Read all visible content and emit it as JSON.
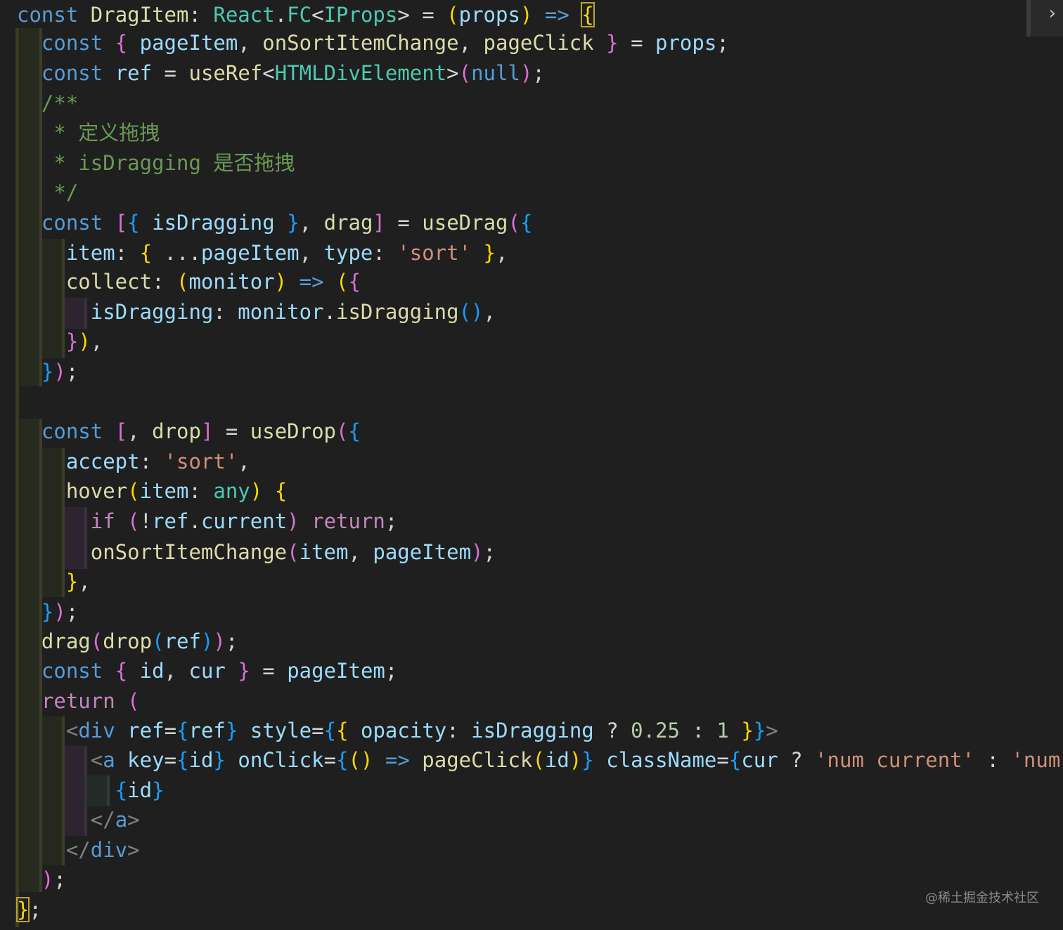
{
  "editor": {
    "lines": [
      [
        [
          "k",
          "const"
        ],
        [
          "p",
          " "
        ],
        [
          "f",
          "DragItem"
        ],
        [
          "p",
          ": "
        ],
        [
          "t",
          "React"
        ],
        [
          "p",
          "."
        ],
        [
          "t",
          "FC"
        ],
        [
          "p",
          "<"
        ],
        [
          "t",
          "IProps"
        ],
        [
          "p",
          "> = "
        ],
        [
          "b1",
          "("
        ],
        [
          "v",
          "props"
        ],
        [
          "b1",
          ")"
        ],
        [
          "p",
          " "
        ],
        [
          "k",
          "=>"
        ],
        [
          "p",
          " "
        ],
        [
          "b1m",
          "{"
        ]
      ],
      [
        [
          "p",
          "  "
        ],
        [
          "k",
          "const"
        ],
        [
          "p",
          " "
        ],
        [
          "b2",
          "{"
        ],
        [
          "p",
          " "
        ],
        [
          "v",
          "pageItem"
        ],
        [
          "p",
          ", "
        ],
        [
          "f",
          "onSortItemChange"
        ],
        [
          "p",
          ", "
        ],
        [
          "f",
          "pageClick"
        ],
        [
          "p",
          " "
        ],
        [
          "b2",
          "}"
        ],
        [
          "p",
          " = "
        ],
        [
          "v",
          "props"
        ],
        [
          "p",
          ";"
        ]
      ],
      [
        [
          "p",
          "  "
        ],
        [
          "k",
          "const"
        ],
        [
          "p",
          " "
        ],
        [
          "v",
          "ref"
        ],
        [
          "p",
          " = "
        ],
        [
          "f",
          "useRef"
        ],
        [
          "p",
          "<"
        ],
        [
          "t",
          "HTMLDivElement"
        ],
        [
          "p",
          ">"
        ],
        [
          "b2",
          "("
        ],
        [
          "k",
          "null"
        ],
        [
          "b2",
          ")"
        ],
        [
          "p",
          ";"
        ]
      ],
      [
        [
          "p",
          "  "
        ],
        [
          "c",
          "/**"
        ]
      ],
      [
        [
          "p",
          "   "
        ],
        [
          "c",
          "* 定义拖拽"
        ]
      ],
      [
        [
          "p",
          "   "
        ],
        [
          "c",
          "* isDragging 是否拖拽"
        ]
      ],
      [
        [
          "p",
          "   "
        ],
        [
          "c",
          "*/"
        ]
      ],
      [
        [
          "p",
          "  "
        ],
        [
          "k",
          "const"
        ],
        [
          "p",
          " "
        ],
        [
          "b2",
          "["
        ],
        [
          "b3",
          "{"
        ],
        [
          "p",
          " "
        ],
        [
          "v",
          "isDragging"
        ],
        [
          "p",
          " "
        ],
        [
          "b3",
          "}"
        ],
        [
          "p",
          ", "
        ],
        [
          "f",
          "drag"
        ],
        [
          "b2",
          "]"
        ],
        [
          "p",
          " = "
        ],
        [
          "f",
          "useDrag"
        ],
        [
          "b2",
          "("
        ],
        [
          "b3",
          "{"
        ]
      ],
      [
        [
          "p",
          "    "
        ],
        [
          "v",
          "item"
        ],
        [
          "p",
          ": "
        ],
        [
          "b1",
          "{"
        ],
        [
          "p",
          " ..."
        ],
        [
          "v",
          "pageItem"
        ],
        [
          "p",
          ", "
        ],
        [
          "v",
          "type"
        ],
        [
          "p",
          ": "
        ],
        [
          "s",
          "'sort'"
        ],
        [
          "p",
          " "
        ],
        [
          "b1",
          "}"
        ],
        [
          "p",
          ","
        ]
      ],
      [
        [
          "p",
          "    "
        ],
        [
          "f",
          "collect"
        ],
        [
          "p",
          ": "
        ],
        [
          "b1",
          "("
        ],
        [
          "v",
          "monitor"
        ],
        [
          "b1",
          ")"
        ],
        [
          "p",
          " "
        ],
        [
          "k",
          "=>"
        ],
        [
          "p",
          " "
        ],
        [
          "b1",
          "("
        ],
        [
          "b2",
          "{"
        ]
      ],
      [
        [
          "p",
          "      "
        ],
        [
          "v",
          "isDragging"
        ],
        [
          "p",
          ": "
        ],
        [
          "v",
          "monitor"
        ],
        [
          "p",
          "."
        ],
        [
          "f",
          "isDragging"
        ],
        [
          "b3",
          "()"
        ],
        [
          "p",
          ","
        ]
      ],
      [
        [
          "p",
          "    "
        ],
        [
          "b2",
          "}"
        ],
        [
          "b1",
          ")"
        ],
        [
          "p",
          ","
        ]
      ],
      [
        [
          "p",
          "  "
        ],
        [
          "b3",
          "}"
        ],
        [
          "b2",
          ")"
        ],
        [
          "p",
          ";"
        ]
      ],
      [],
      [
        [
          "p",
          "  "
        ],
        [
          "k",
          "const"
        ],
        [
          "p",
          " "
        ],
        [
          "b2",
          "["
        ],
        [
          "p",
          ", "
        ],
        [
          "f",
          "drop"
        ],
        [
          "b2",
          "]"
        ],
        [
          "p",
          " = "
        ],
        [
          "f",
          "useDrop"
        ],
        [
          "b2",
          "("
        ],
        [
          "b3",
          "{"
        ]
      ],
      [
        [
          "p",
          "    "
        ],
        [
          "v",
          "accept"
        ],
        [
          "p",
          ": "
        ],
        [
          "s",
          "'sort'"
        ],
        [
          "p",
          ","
        ]
      ],
      [
        [
          "p",
          "    "
        ],
        [
          "f",
          "hover"
        ],
        [
          "b1",
          "("
        ],
        [
          "v",
          "item"
        ],
        [
          "p",
          ": "
        ],
        [
          "t",
          "any"
        ],
        [
          "b1",
          ")"
        ],
        [
          "p",
          " "
        ],
        [
          "b1",
          "{"
        ]
      ],
      [
        [
          "p",
          "      "
        ],
        [
          "ct",
          "if"
        ],
        [
          "p",
          " "
        ],
        [
          "b2",
          "("
        ],
        [
          "p",
          "!"
        ],
        [
          "v",
          "ref"
        ],
        [
          "p",
          "."
        ],
        [
          "v",
          "current"
        ],
        [
          "b2",
          ")"
        ],
        [
          "p",
          " "
        ],
        [
          "ct",
          "return"
        ],
        [
          "p",
          ";"
        ]
      ],
      [
        [
          "p",
          "      "
        ],
        [
          "f",
          "onSortItemChange"
        ],
        [
          "b2",
          "("
        ],
        [
          "v",
          "item"
        ],
        [
          "p",
          ", "
        ],
        [
          "v",
          "pageItem"
        ],
        [
          "b2",
          ")"
        ],
        [
          "p",
          ";"
        ]
      ],
      [
        [
          "p",
          "    "
        ],
        [
          "b1",
          "}"
        ],
        [
          "p",
          ","
        ]
      ],
      [
        [
          "p",
          "  "
        ],
        [
          "b3",
          "}"
        ],
        [
          "b2",
          ")"
        ],
        [
          "p",
          ";"
        ]
      ],
      [
        [
          "p",
          "  "
        ],
        [
          "f",
          "drag"
        ],
        [
          "b2",
          "("
        ],
        [
          "f",
          "drop"
        ],
        [
          "b3",
          "("
        ],
        [
          "v",
          "ref"
        ],
        [
          "b3",
          ")"
        ],
        [
          "b2",
          ")"
        ],
        [
          "p",
          ";"
        ]
      ],
      [
        [
          "p",
          "  "
        ],
        [
          "k",
          "const"
        ],
        [
          "p",
          " "
        ],
        [
          "b2",
          "{"
        ],
        [
          "p",
          " "
        ],
        [
          "v",
          "id"
        ],
        [
          "p",
          ", "
        ],
        [
          "v",
          "cur"
        ],
        [
          "p",
          " "
        ],
        [
          "b2",
          "}"
        ],
        [
          "p",
          " = "
        ],
        [
          "v",
          "pageItem"
        ],
        [
          "p",
          ";"
        ]
      ],
      [
        [
          "p",
          "  "
        ],
        [
          "ct",
          "return"
        ],
        [
          "p",
          " "
        ],
        [
          "b2",
          "("
        ]
      ],
      [
        [
          "p",
          "    "
        ],
        [
          "tg",
          "<"
        ],
        [
          "k",
          "div"
        ],
        [
          "p",
          " "
        ],
        [
          "v",
          "ref"
        ],
        [
          "p",
          "="
        ],
        [
          "b3",
          "{"
        ],
        [
          "v",
          "ref"
        ],
        [
          "b3",
          "}"
        ],
        [
          "p",
          " "
        ],
        [
          "v",
          "style"
        ],
        [
          "p",
          "="
        ],
        [
          "b3",
          "{"
        ],
        [
          "b1",
          "{"
        ],
        [
          "p",
          " "
        ],
        [
          "v",
          "opacity"
        ],
        [
          "p",
          ": "
        ],
        [
          "v",
          "isDragging"
        ],
        [
          "p",
          " ? "
        ],
        [
          "n",
          "0.25"
        ],
        [
          "p",
          " : "
        ],
        [
          "n",
          "1"
        ],
        [
          "p",
          " "
        ],
        [
          "b1",
          "}"
        ],
        [
          "b3",
          "}"
        ],
        [
          "tg",
          ">"
        ]
      ],
      [
        [
          "p",
          "      "
        ],
        [
          "tg",
          "<"
        ],
        [
          "k",
          "a"
        ],
        [
          "p",
          " "
        ],
        [
          "v",
          "key"
        ],
        [
          "p",
          "="
        ],
        [
          "b3",
          "{"
        ],
        [
          "v",
          "id"
        ],
        [
          "b3",
          "}"
        ],
        [
          "p",
          " "
        ],
        [
          "v",
          "onClick"
        ],
        [
          "p",
          "="
        ],
        [
          "b3",
          "{"
        ],
        [
          "b1",
          "()"
        ],
        [
          "p",
          " "
        ],
        [
          "k",
          "=>"
        ],
        [
          "p",
          " "
        ],
        [
          "f",
          "pageClick"
        ],
        [
          "b1",
          "("
        ],
        [
          "v",
          "id"
        ],
        [
          "b1",
          ")"
        ],
        [
          "b3",
          "}"
        ],
        [
          "p",
          " "
        ],
        [
          "v",
          "className"
        ],
        [
          "p",
          "="
        ],
        [
          "b3",
          "{"
        ],
        [
          "v",
          "cur"
        ],
        [
          "p",
          " ? "
        ],
        [
          "s",
          "'num current'"
        ],
        [
          "p",
          " : "
        ],
        [
          "s",
          "'num'"
        ],
        [
          "b3",
          "}"
        ]
      ],
      [
        [
          "p",
          "        "
        ],
        [
          "b3",
          "{"
        ],
        [
          "v",
          "id"
        ],
        [
          "b3",
          "}"
        ]
      ],
      [
        [
          "p",
          "      "
        ],
        [
          "tg",
          "</"
        ],
        [
          "k",
          "a"
        ],
        [
          "tg",
          ">"
        ]
      ],
      [
        [
          "p",
          "    "
        ],
        [
          "tg",
          "</"
        ],
        [
          "k",
          "div"
        ],
        [
          "tg",
          ">"
        ]
      ],
      [
        [
          "p",
          "  "
        ],
        [
          "b2",
          ")"
        ],
        [
          "p",
          ";"
        ]
      ],
      [
        [
          "b1m",
          "}"
        ],
        [
          "p",
          ";"
        ]
      ]
    ]
  },
  "watermark": "@稀土掘金技术社区",
  "icons": {
    "scroll_chevron": "chevron-right-icon"
  },
  "colors": {
    "background": "#1f1f1f",
    "keyword": "#569cd6",
    "control": "#c586c0",
    "variable": "#9cdcfe",
    "function": "#dcdcaa",
    "type": "#4ec9b0",
    "string": "#ce9178",
    "number": "#b5cea8",
    "comment": "#6a9955",
    "bracket_gold": "#ffd700",
    "bracket_orchid": "#da70d6",
    "bracket_blue": "#179fff"
  }
}
